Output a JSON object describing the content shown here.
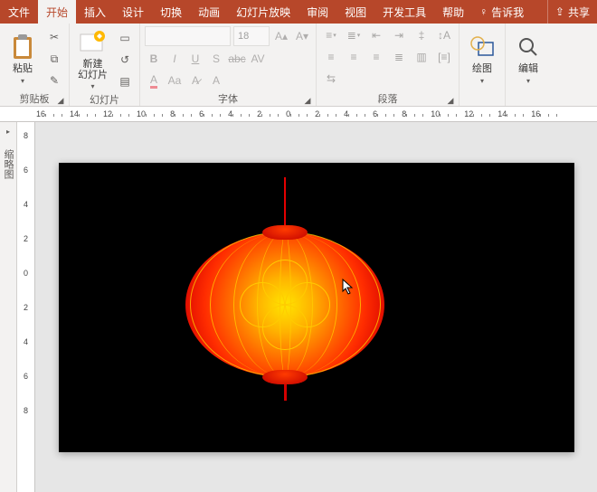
{
  "menu": {
    "file": "文件",
    "home": "开始",
    "insert": "插入",
    "design": "设计",
    "transitions": "切换",
    "animations": "动画",
    "slideshow": "幻灯片放映",
    "review": "审阅",
    "view": "视图",
    "devtools": "开发工具",
    "help": "帮助",
    "tellme": "告诉我",
    "share": "共享"
  },
  "ribbon": {
    "clipboard": {
      "paste": "粘贴",
      "label": "剪贴板"
    },
    "slides": {
      "newslide": "新建\n幻灯片",
      "label": "幻灯片"
    },
    "font": {
      "name": "",
      "size": "18",
      "label": "字体"
    },
    "paragraph": {
      "label": "段落"
    },
    "drawing": {
      "draw": "绘图",
      "label": ""
    },
    "editing": {
      "edit": "编辑",
      "label": ""
    }
  },
  "ruler_h": [
    "16",
    "14",
    "12",
    "10",
    "8",
    "6",
    "4",
    "2",
    "0",
    "2",
    "4",
    "6",
    "8",
    "10",
    "12",
    "14",
    "16"
  ],
  "ruler_v": [
    "8",
    "6",
    "4",
    "2",
    "0",
    "2",
    "4",
    "6",
    "8"
  ],
  "panel": {
    "outline": "缩略图"
  },
  "colors": {
    "accent": "#b7472a"
  }
}
